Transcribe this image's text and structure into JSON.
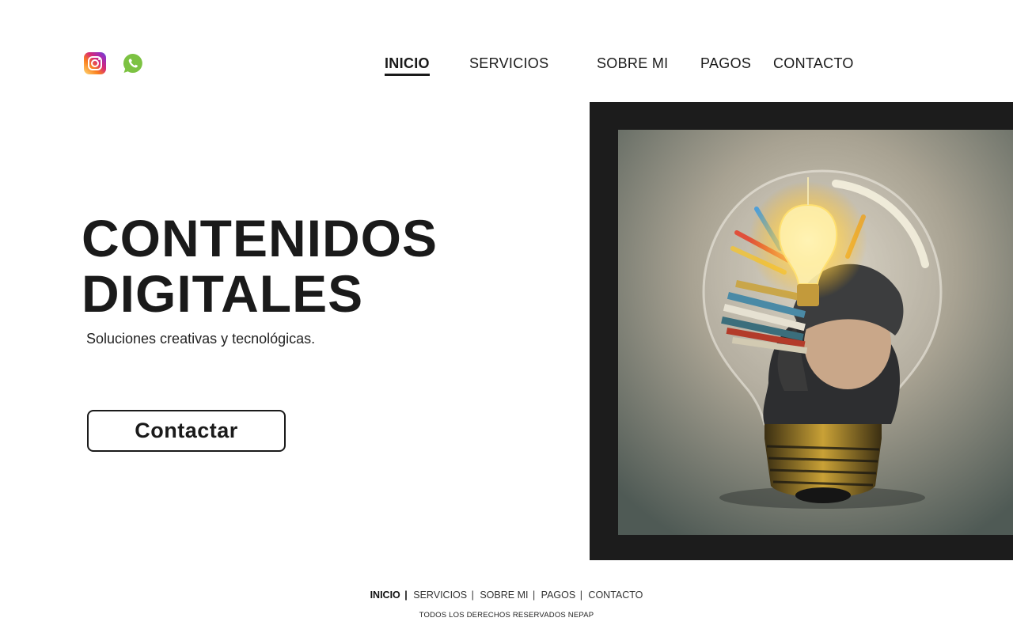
{
  "social": [
    {
      "name": "instagram-icon",
      "color": "#c13584"
    },
    {
      "name": "whatsapp-icon",
      "color": "#7cc242"
    }
  ],
  "nav": {
    "items": [
      "INICIO",
      "SERVICIOS",
      "SOBRE MI",
      "PAGOS",
      "CONTACTO"
    ],
    "active": "INICIO"
  },
  "hero": {
    "title_line1": "CONTENIDOS",
    "title_line2": "DIGITALES",
    "subtitle": "Soluciones creativas y tecnológicas.",
    "button_label": "Contactar"
  },
  "image": {
    "icon": "lightbulb-child-books-illustration",
    "frame_color": "#1c1c1c"
  },
  "footer": {
    "nav": [
      "INICIO",
      "SERVICIOS",
      "SOBRE MI",
      "PAGOS",
      "CONTACTO"
    ],
    "separator": "|",
    "copyright": "TODOS LOS DERECHOS RESERVADOS  NEPAP"
  }
}
